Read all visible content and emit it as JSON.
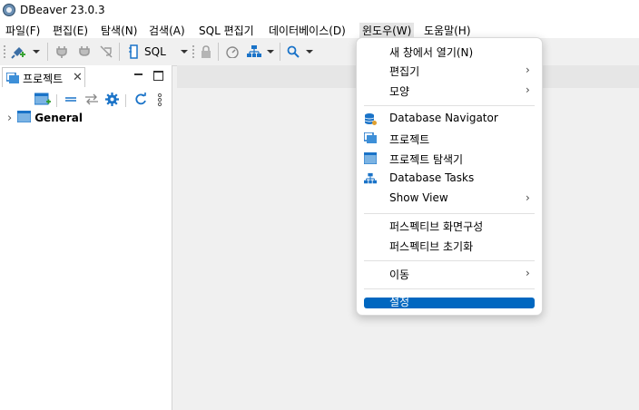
{
  "window": {
    "title": "DBeaver 23.0.3"
  },
  "menubar": {
    "items": [
      {
        "label": "파일(F)"
      },
      {
        "label": "편집(E)"
      },
      {
        "label": "탐색(N)"
      },
      {
        "label": "검색(A)"
      },
      {
        "label": "SQL 편집기"
      },
      {
        "label": "데이터베이스(D)"
      },
      {
        "label": "윈도우(W)"
      },
      {
        "label": "도움말(H)"
      }
    ]
  },
  "toolbar": {
    "sql_label": "SQL"
  },
  "project_panel": {
    "tab_label": "프로젝트",
    "tree": [
      {
        "label": "General"
      }
    ]
  },
  "window_menu": {
    "items": [
      {
        "label": "새 창에서 열기(N)"
      },
      {
        "label": "편집기"
      },
      {
        "label": "모양"
      },
      {
        "label": "Database Navigator"
      },
      {
        "label": "프로젝트"
      },
      {
        "label": "프로젝트 탐색기"
      },
      {
        "label": "Database Tasks"
      },
      {
        "label": "Show View"
      },
      {
        "label": "퍼스펙티브 화면구성"
      },
      {
        "label": "퍼스펙티브 초기화"
      },
      {
        "label": "이동"
      },
      {
        "label": "설정"
      }
    ],
    "submenu_arrow": "›"
  },
  "colors": {
    "accent": "#0067c0",
    "icon_blue": "#1a73c8"
  }
}
